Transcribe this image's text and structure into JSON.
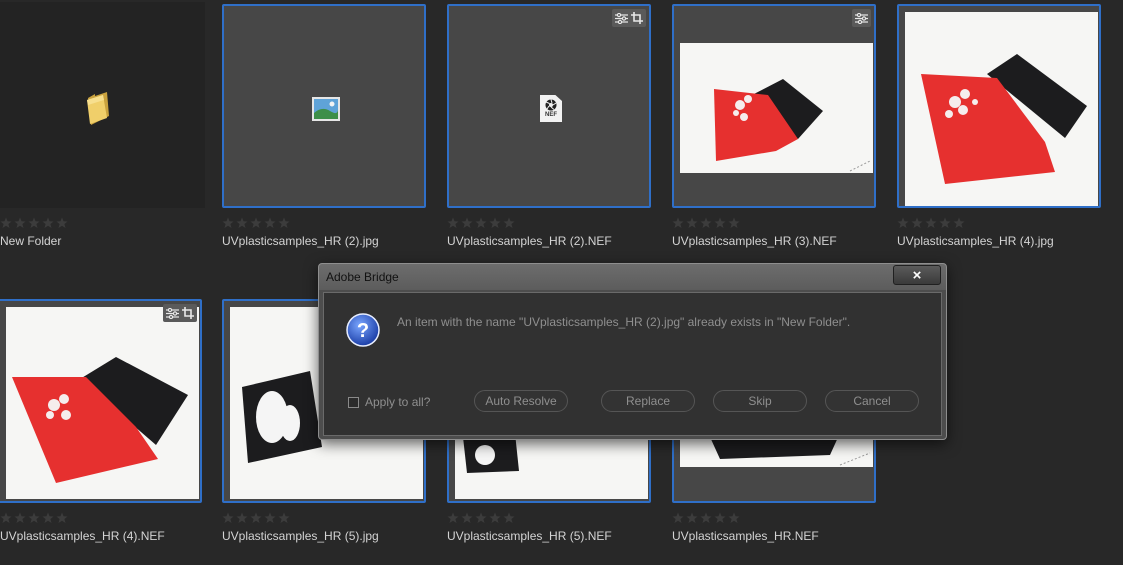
{
  "items": [
    {
      "name": "New Folder",
      "type": "folder"
    },
    {
      "name": "UVplasticsamples_HR (2).jpg",
      "type": "generic-image"
    },
    {
      "name": "UVplasticsamples_HR (2).NEF",
      "type": "nef",
      "badges": [
        "adjust-icon",
        "crop-icon"
      ],
      "file_icon_text": "NEF"
    },
    {
      "name": "UVplasticsamples_HR (3).NEF",
      "type": "photo",
      "badges": [
        "adjust-icon"
      ]
    },
    {
      "name": "UVplasticsamples_HR (4).jpg",
      "type": "photo"
    },
    {
      "name": "UVplasticsamples_HR (4).NEF",
      "type": "photo",
      "badges": [
        "adjust-icon",
        "crop-icon"
      ]
    },
    {
      "name": "UVplasticsamples_HR (5).jpg",
      "type": "photo"
    },
    {
      "name": "UVplasticsamples_HR (5).NEF",
      "type": "photo"
    },
    {
      "name": "UVplasticsamples_HR.NEF",
      "type": "photo"
    }
  ],
  "rating": {
    "max_stars": 5,
    "value": 0
  },
  "dialog": {
    "title": "Adobe Bridge",
    "close_label": "×",
    "icon": "question-icon",
    "message": "An item with the name \"UVplasticsamples_HR (2).jpg\" already exists in \"New Folder\".",
    "apply_all_label": "Apply to all?",
    "apply_all_checked": false,
    "buttons": {
      "auto_resolve": "Auto Resolve",
      "replace": "Replace",
      "skip": "Skip",
      "cancel": "Cancel"
    }
  },
  "colors": {
    "background": "#282828",
    "selection_border": "#2f6fc8",
    "tile": "#474747",
    "red_sample": "#e6302f",
    "black_sample": "#1c1c1e"
  }
}
